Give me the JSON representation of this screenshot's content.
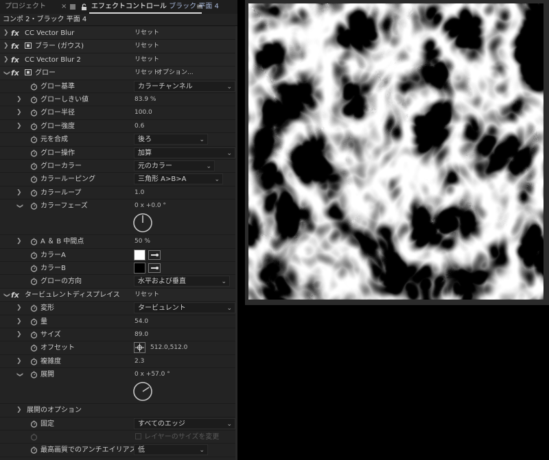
{
  "tabs": {
    "project": "プロジェクト",
    "close": "×",
    "effect_controls": "エフェクトコントロール",
    "effect_controls_target": "ブラック 平面 4",
    "menu": "≡"
  },
  "breadcrumb": "コンポ 2・ブラック 平面 4",
  "effects": {
    "cc_vector_blur": {
      "name": "CC Vector Blur",
      "reset": "リセット"
    },
    "gaussian_blur": {
      "name": "ブラー (ガウス)",
      "reset": "リセット"
    },
    "cc_vector_blur_2": {
      "name": "CC Vector Blur 2",
      "reset": "リセット"
    },
    "glow": {
      "name": "グロー",
      "reset": "リセット",
      "options": "オプション...",
      "params": {
        "base": {
          "label": "グロー基準",
          "value": "カラーチャンネル"
        },
        "threshold": {
          "label": "グローしきい値",
          "value": "83.9 %"
        },
        "radius": {
          "label": "グロー半径",
          "value": "100.0"
        },
        "intensity": {
          "label": "グロー強度",
          "value": "0.6"
        },
        "composite": {
          "label": "元を合成",
          "value": "後ろ"
        },
        "operation": {
          "label": "グロー操作",
          "value": "加算"
        },
        "colors": {
          "label": "グローカラー",
          "value": "元のカラー"
        },
        "color_looping": {
          "label": "カラールーピング",
          "value": "三角形 A>B>A"
        },
        "color_loops": {
          "label": "カラーループ",
          "value": "1.0"
        },
        "color_phase": {
          "label": "カラーフェーズ",
          "value": "0 x +0.0 °",
          "angle": 0
        },
        "ab_midpoint": {
          "label": "A ＆ B 中間点",
          "value": "50 %"
        },
        "color_a": {
          "label": "カラーA",
          "color": "#ffffff"
        },
        "color_b": {
          "label": "カラーB",
          "color": "#000000"
        },
        "dimensions": {
          "label": "グローの方向",
          "value": "水平および垂直"
        }
      }
    },
    "turbulent_displace": {
      "name": "タービュレントディスプレイス",
      "reset": "リセット",
      "params": {
        "displacement": {
          "label": "変形",
          "value": "タービュレント"
        },
        "amount": {
          "label": "量",
          "value": "54.0"
        },
        "size": {
          "label": "サイズ",
          "value": "89.0"
        },
        "offset": {
          "label": "オフセット",
          "value": "512.0,512.0"
        },
        "complexity": {
          "label": "複雑度",
          "value": "2.3"
        },
        "evolution": {
          "label": "展開",
          "value": "0 x +57.0 °",
          "angle": 57
        },
        "evolution_options": {
          "label": "展開のオプション"
        },
        "pinning": {
          "label": "固定",
          "value": "すべてのエッジ"
        },
        "resize_layer": {
          "label": "レイヤーのサイズを変更"
        },
        "antialiasing": {
          "label": "最高画質でのアンチエイリアス",
          "value": "低"
        }
      }
    }
  },
  "icons": {
    "fx": "fx-icon",
    "stopwatch": "stopwatch-icon",
    "lock": "lock-icon",
    "twisty": "chevron-icon"
  },
  "colors": {
    "panel_bg": "#232323",
    "tab_bg": "#1e1e1e",
    "viewer_frame": "#2b2b2b",
    "selected_tab_text": "#ffffff",
    "target_text": "#a6b6d8"
  }
}
